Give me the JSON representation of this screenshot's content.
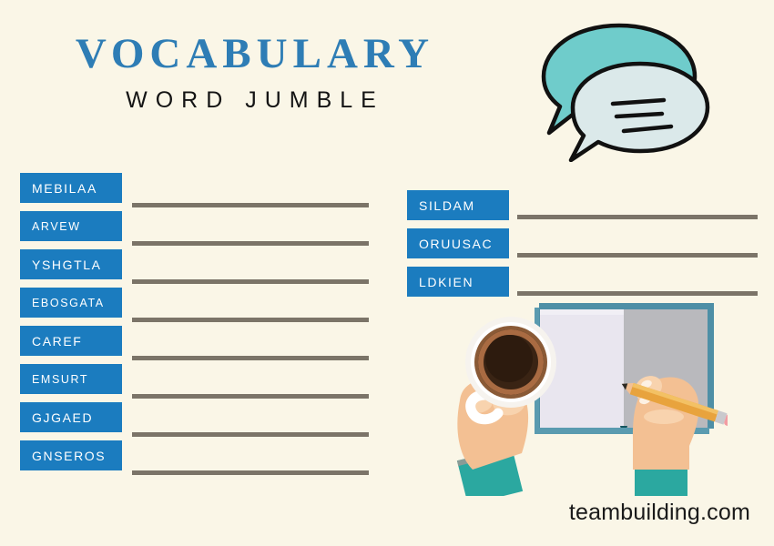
{
  "header": {
    "title": "VOCABULARY",
    "subtitle": "WORD JUMBLE"
  },
  "footer": {
    "brand": "teambuilding.com"
  },
  "colors": {
    "background": "#faf6e7",
    "title_blue": "#2e7db5",
    "box_blue": "#1b7cbf",
    "line_gray": "#7b7468",
    "bubble_teal": "#6fcccb",
    "bubble_pale": "#dbe9ea",
    "sleeve_teal": "#2ba8a0",
    "skin": "#f3c093",
    "pencil_yellow": "#e8a33d",
    "eraser_pink": "#f29ca3",
    "book_cover": "#5a9bb0"
  },
  "left_column": {
    "items": [
      {
        "word": "MEBILAA",
        "size": "large"
      },
      {
        "word": "ARVEW",
        "size": "small"
      },
      {
        "word": "YSHGTLA",
        "size": "large"
      },
      {
        "word": "EBOSGATA",
        "size": "small"
      },
      {
        "word": "CAREF",
        "size": "large"
      },
      {
        "word": "EMSURT",
        "size": "small"
      },
      {
        "word": "GJGAED",
        "size": "large"
      },
      {
        "word": "GNSEROS",
        "size": "large"
      }
    ]
  },
  "right_column": {
    "items": [
      {
        "word": "SILDAM",
        "size": "large"
      },
      {
        "word": "ORUUSAC",
        "size": "large"
      },
      {
        "word": "LDKIEN",
        "size": "large"
      }
    ]
  },
  "artwork": {
    "speech_bubbles": "speech-bubbles-illustration",
    "desk_scene": "hands-coffee-book-pencil-illustration"
  }
}
